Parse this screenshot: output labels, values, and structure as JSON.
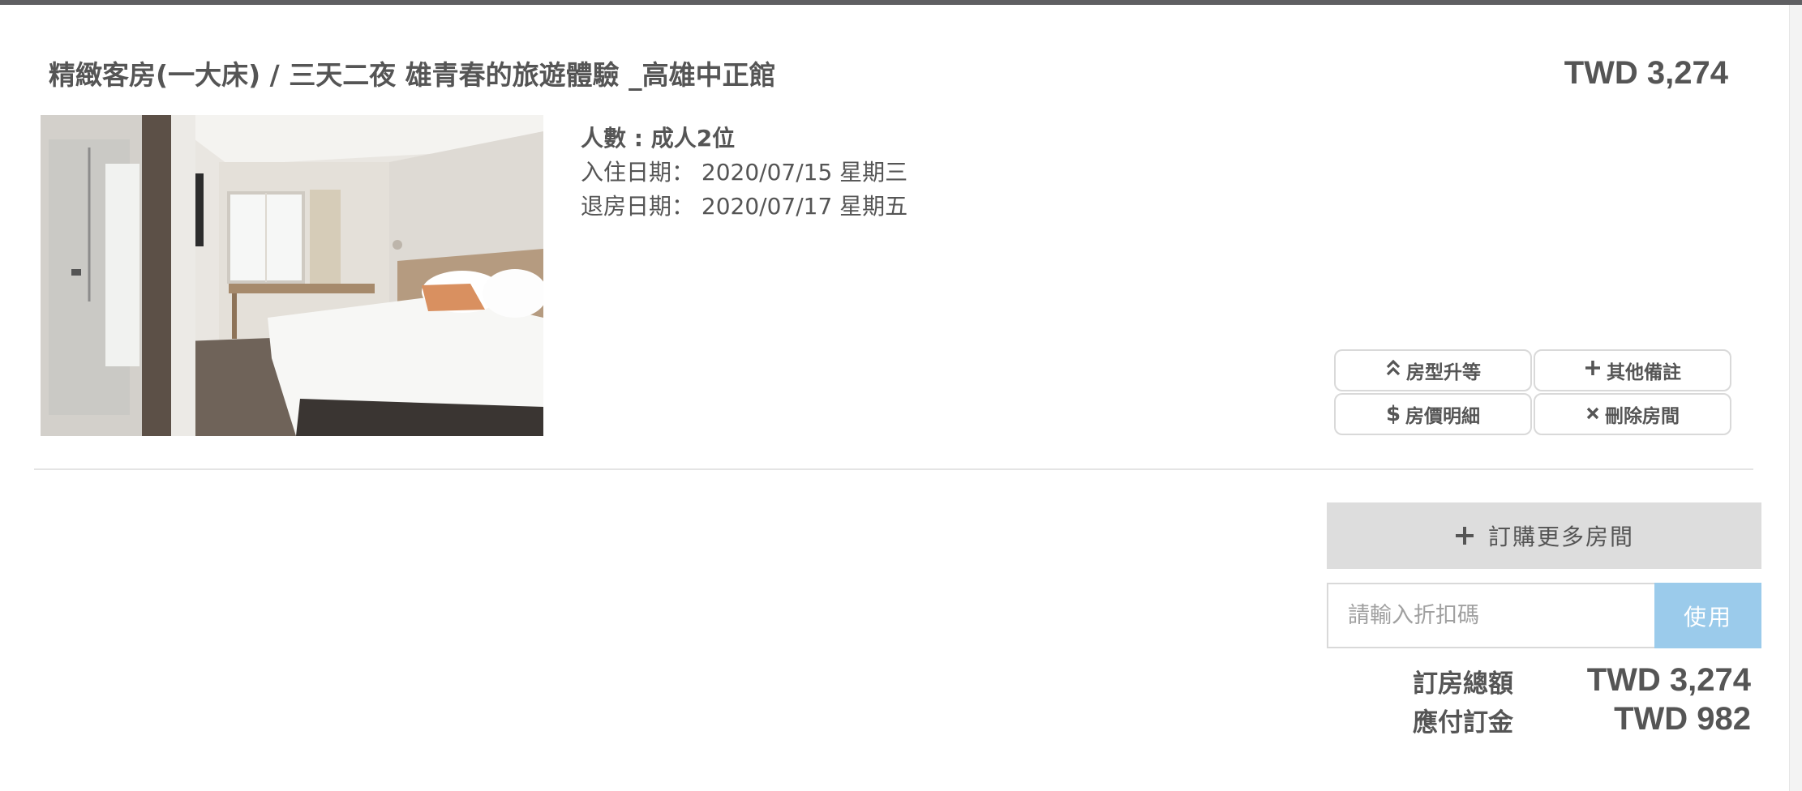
{
  "room": {
    "title": "精緻客房(一大床) / 三天二夜 雄青春的旅遊體驗 _高雄中正館",
    "price": "TWD 3,274",
    "guests": "人數 : 成人2位",
    "checkin": "入住日期： 2020/07/15 星期三",
    "checkout": "退房日期： 2020/07/17 星期五",
    "photo_icon": "hotel-room-photo"
  },
  "actions": {
    "upgrade": {
      "label": "房型升等",
      "icon": "chevron-double-up-icon",
      "glyph": "⌃"
    },
    "notes": {
      "label": "其他備註",
      "icon": "plus-icon",
      "glyph": "✚"
    },
    "price_detail": {
      "label": "房價明細",
      "icon": "dollar-icon",
      "glyph": "$"
    },
    "delete": {
      "label": "刪除房間",
      "icon": "close-icon",
      "glyph": "✖"
    }
  },
  "more_rooms": {
    "label": "訂購更多房間",
    "glyph": "✚",
    "icon": "plus-icon"
  },
  "coupon": {
    "placeholder": "請輸入折扣碼",
    "value": "",
    "apply_label": "使用"
  },
  "summary": {
    "total_label": "訂房總額",
    "total_value": "TWD 3,274",
    "deposit_label": "應付訂金",
    "deposit_value": "TWD 982"
  },
  "colors": {
    "text": "#555555",
    "apply_button": "#9bcbeb",
    "more_rooms_bg": "#dddddd",
    "border": "#d9d9d9"
  }
}
